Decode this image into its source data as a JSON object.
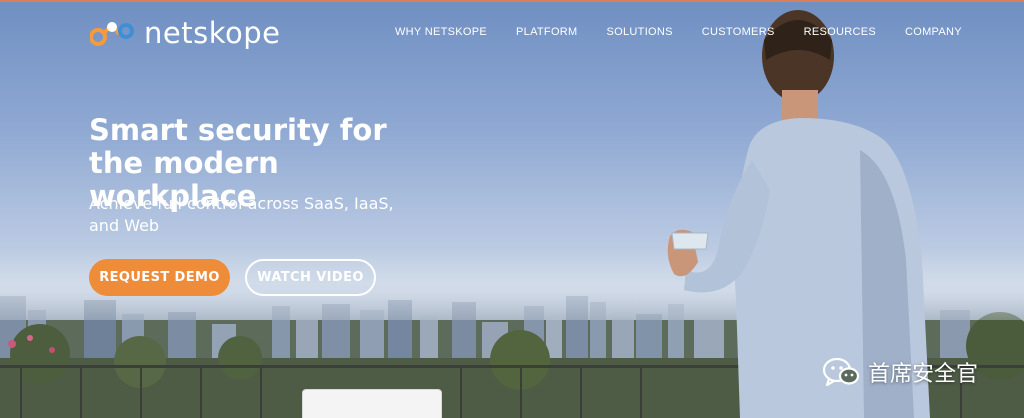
{
  "header": {
    "logo": {
      "icon": "netskope-logo-icon",
      "text": "netskope"
    },
    "nav": [
      {
        "label": "WHY NETSKOPE"
      },
      {
        "label": "PLATFORM"
      },
      {
        "label": "SOLUTIONS"
      },
      {
        "label": "CUSTOMERS"
      },
      {
        "label": "RESOURCES"
      },
      {
        "label": "COMPANY"
      }
    ]
  },
  "hero": {
    "headline": "Smart security for the modern workplace",
    "subheadline": "Achieve full control across SaaS, IaaS, and Web",
    "primary_button": "REQUEST DEMO",
    "secondary_button": "WATCH VIDEO"
  },
  "watermark": {
    "icon": "wechat-icon",
    "text": "首席安全官"
  },
  "colors": {
    "accent": "#ef8c3a",
    "logo_orange": "#f59a3d",
    "logo_blue": "#3f8fd6",
    "text_light": "#ffffff"
  }
}
